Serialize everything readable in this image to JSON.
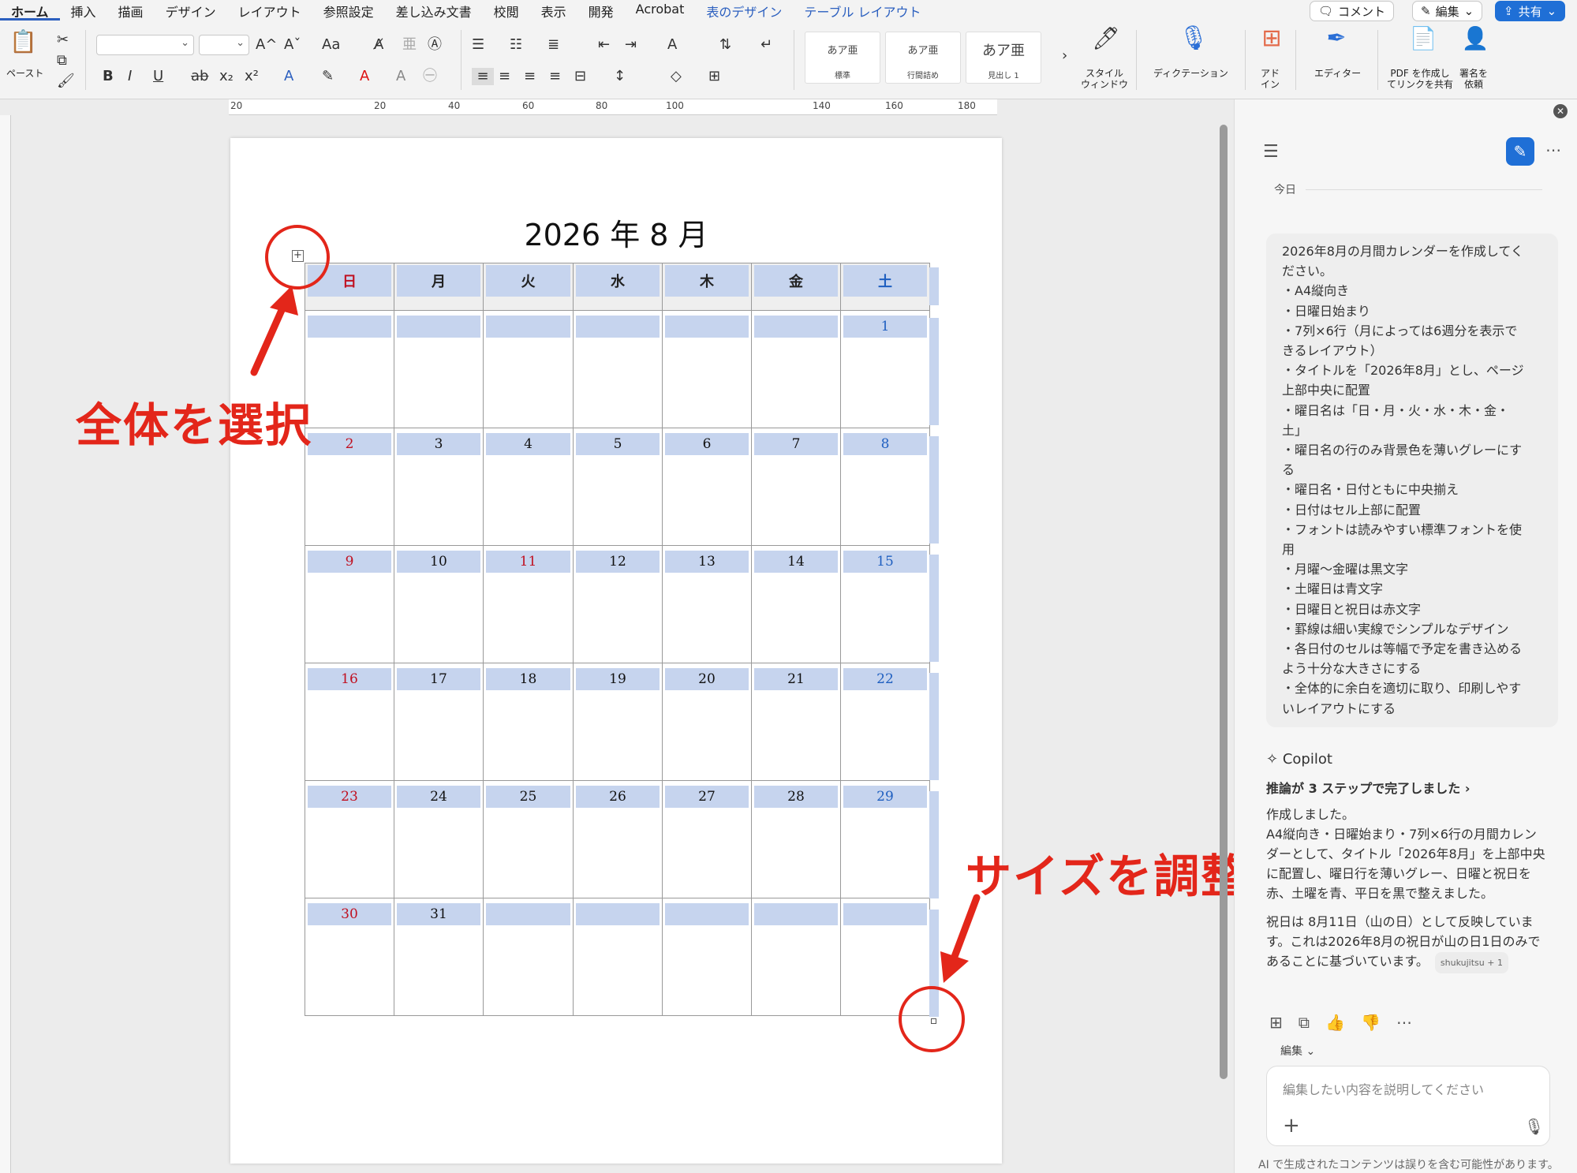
{
  "ribbon": {
    "tabs": [
      "ホーム",
      "挿入",
      "描画",
      "デザイン",
      "レイアウト",
      "参照設定",
      "差し込み文書",
      "校閲",
      "表示",
      "開発",
      "Acrobat",
      "表のデザイン",
      "テーブル レイアウト"
    ],
    "active_tab": "ホーム",
    "contextual_tabs": [
      "表のデザイン",
      "テーブル レイアウト"
    ],
    "comment_label": "コメント",
    "edit_label": "編集",
    "share_label": "共有",
    "paste_label": "ペースト",
    "style_gallery": [
      {
        "preview": "あア亜",
        "name": "標準"
      },
      {
        "preview": "あア亜",
        "name": "行間詰め"
      },
      {
        "preview": "あア亜",
        "name": "見出し 1"
      }
    ],
    "style_window_label": [
      "スタイル",
      "ウィンドウ"
    ],
    "dictation_label": "ディクテーション",
    "addins_label": [
      "アド",
      "イン"
    ],
    "editor_label": "エディター",
    "pdf_label": [
      "PDF を作成し",
      "てリンクを共有"
    ],
    "sign_label": [
      "署名を",
      "依頼"
    ]
  },
  "ruler": {
    "numbers": [
      "20",
      "20",
      "40",
      "60",
      "80",
      "100",
      "140",
      "160",
      "180"
    ]
  },
  "document": {
    "title": "2026 年 8 月",
    "weekdays": [
      "日",
      "月",
      "火",
      "水",
      "木",
      "金",
      "土"
    ],
    "weeks": [
      [
        "",
        "",
        "",
        "",
        "",
        "",
        "1"
      ],
      [
        "2",
        "3",
        "4",
        "5",
        "6",
        "7",
        "8"
      ],
      [
        "9",
        "10",
        "11",
        "12",
        "13",
        "14",
        "15"
      ],
      [
        "16",
        "17",
        "18",
        "19",
        "20",
        "21",
        "22"
      ],
      [
        "23",
        "24",
        "25",
        "26",
        "27",
        "28",
        "29"
      ],
      [
        "30",
        "31",
        "",
        "",
        "",
        "",
        ""
      ]
    ],
    "holidays": [
      "11"
    ],
    "colors": {
      "sunday_holiday": "#c01020",
      "saturday": "#1f5fc0",
      "band": "#c6d4ee",
      "header_bg": "#efefef"
    }
  },
  "annotations": {
    "select_all": "全体を選択",
    "resize": "サイズを調整",
    "color": "#e3261a"
  },
  "copilot": {
    "date_label": "今日",
    "prompt_lines": [
      "2026年8月の月間カレンダーを作成してく",
      "ださい。",
      "・A4縦向き",
      "・日曜日始まり",
      "・7列×6行（月によっては6週分を表示で",
      "きるレイアウト）",
      "・タイトルを「2026年8月」とし、ページ",
      "上部中央に配置",
      "・曜日名は「日・月・火・水・木・金・",
      "土」",
      "・曜日名の行のみ背景色を薄いグレーにす",
      "る",
      "・曜日名・日付ともに中央揃え",
      "・日付はセル上部に配置",
      "・フォントは読みやすい標準フォントを使",
      "用",
      "・月曜〜金曜は黒文字",
      "・土曜日は青文字",
      "・日曜日と祝日は赤文字",
      "・罫線は細い実線でシンプルなデザイン",
      "・各日付のセルは等幅で予定を書き込める",
      "よう十分な大きさにする",
      "・全体的に余白を適切に取り、印刷しやす",
      "いレイアウトにする"
    ],
    "assistant_name": "Copilot",
    "reasoning": "推論が 3 ステップで完了しました",
    "response_lines": [
      "作成しました。",
      "A4縦向き・日曜始まり・7列×6行の月間カレン",
      "ダーとして、タイトル「2026年8月」を上部中央",
      "に配置し、曜日行を薄いグレー、日曜と祝日を",
      "赤、土曜を青、平日を黒で整えました。"
    ],
    "holiday_lines": [
      "祝日は 8月11日（山の日）として反映していま",
      "す。これは2026年8月の祝日が山の日1日のみで",
      "あることに基づいています。"
    ],
    "source_chip": "shukujitsu + 1",
    "edit_dropdown": "編集",
    "input_placeholder": "編集したい内容を説明してください",
    "disclaimer": "AI で生成されたコンテンツは誤りを含む可能性があります。"
  }
}
